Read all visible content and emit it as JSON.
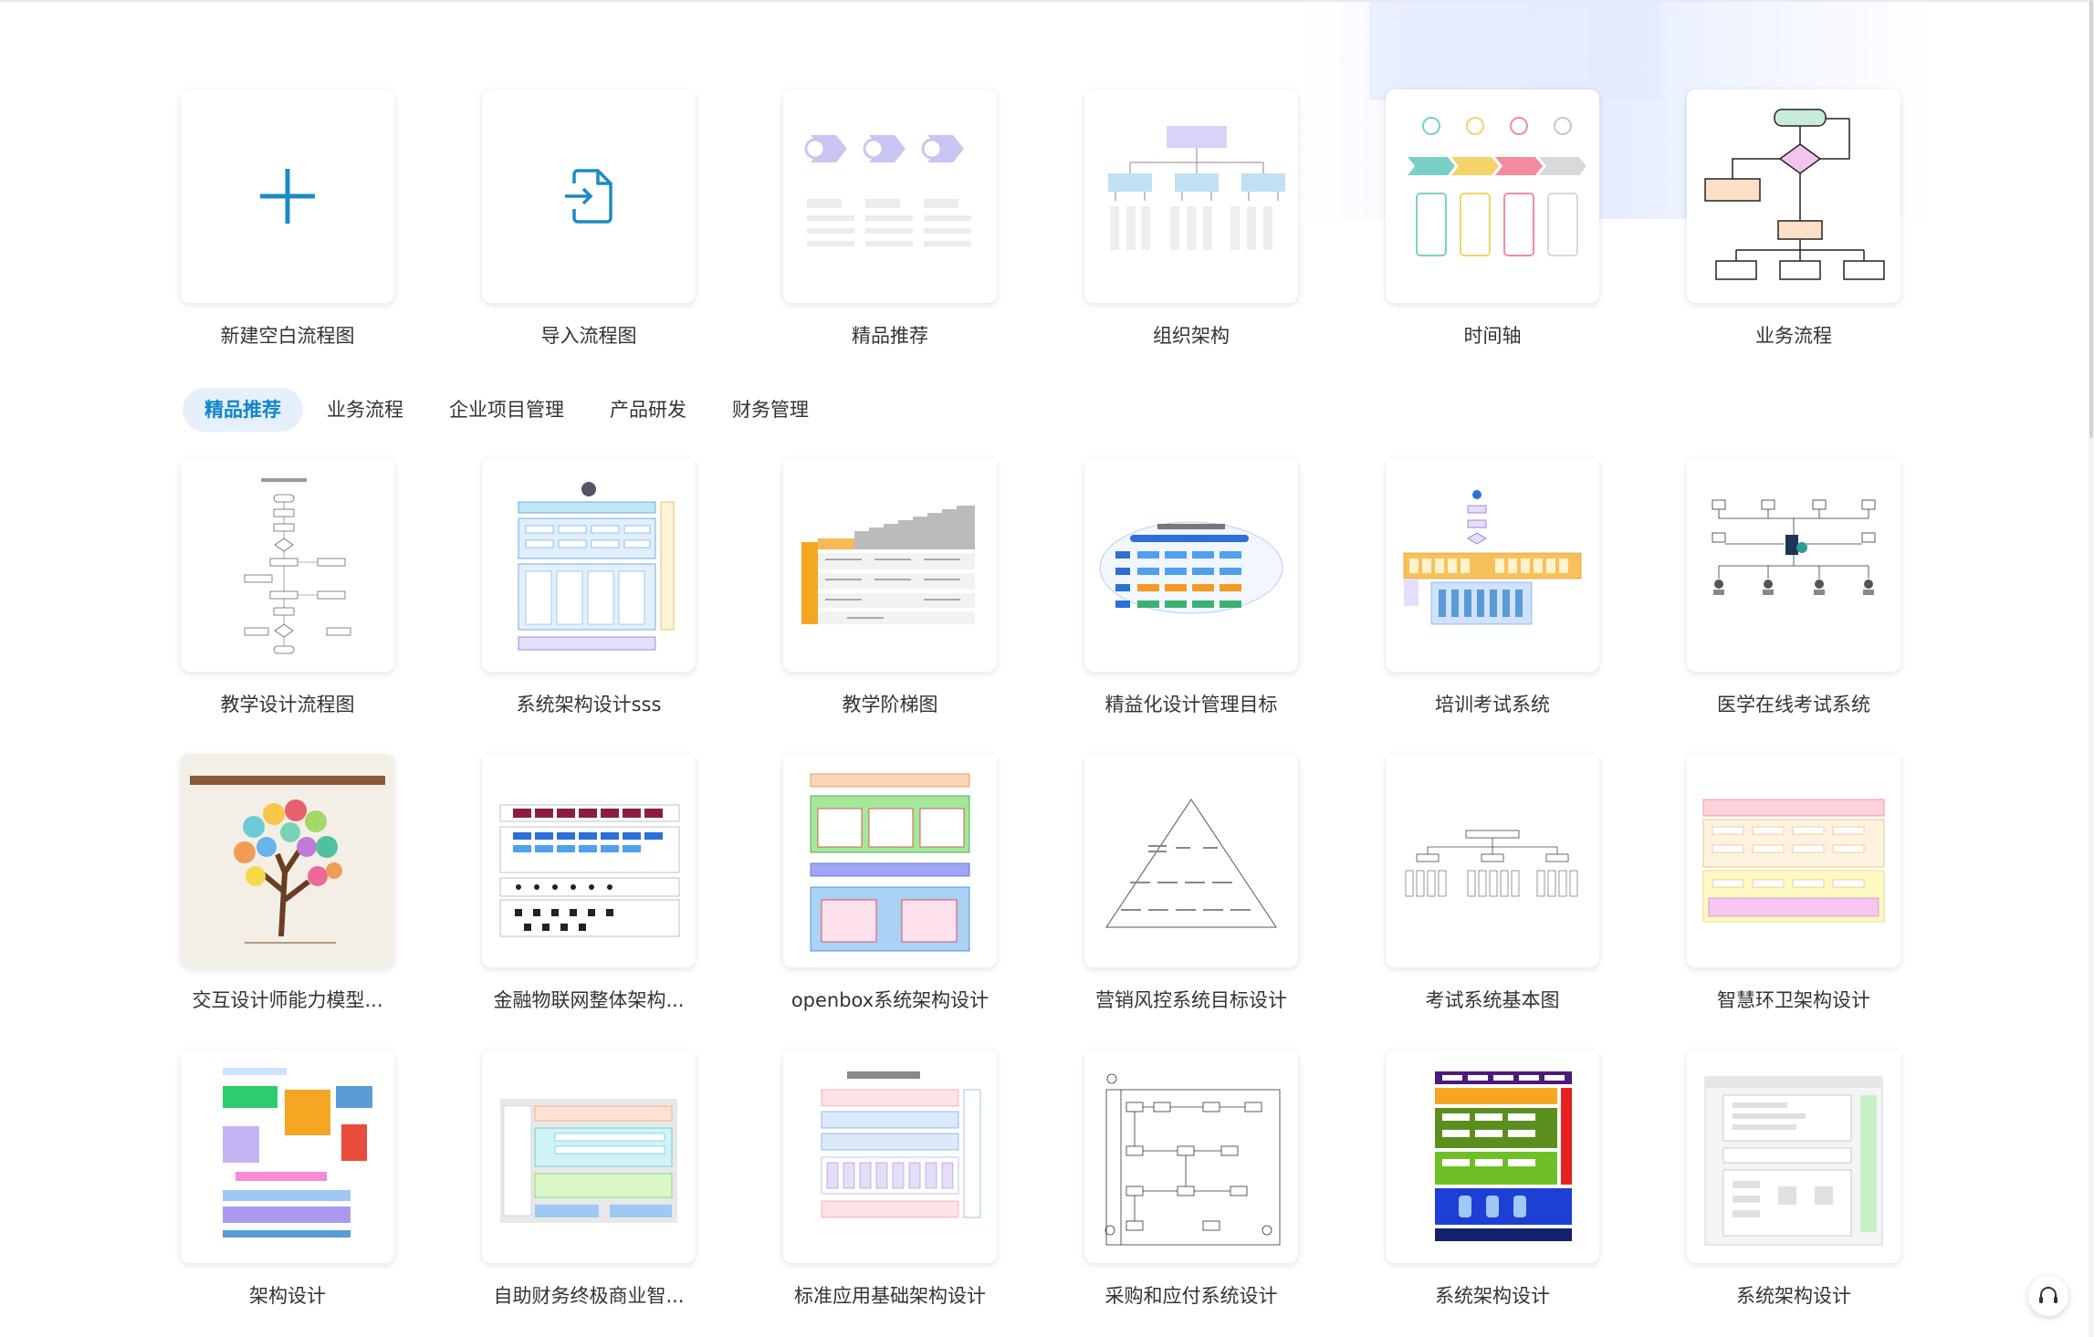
{
  "quick_actions": [
    {
      "label": "新建空白流程图",
      "icon": "plus-icon"
    },
    {
      "label": "导入流程图",
      "icon": "import-file-icon"
    },
    {
      "label": "精品推荐",
      "icon": "premium-preview"
    },
    {
      "label": "组织架构",
      "icon": "org-chart-preview"
    },
    {
      "label": "时间轴",
      "icon": "timeline-preview"
    },
    {
      "label": "业务流程",
      "icon": "business-flow-preview"
    }
  ],
  "tabs": [
    {
      "label": "精品推荐",
      "active": true
    },
    {
      "label": "业务流程",
      "active": false
    },
    {
      "label": "企业项目管理",
      "active": false
    },
    {
      "label": "产品研发",
      "active": false
    },
    {
      "label": "财务管理",
      "active": false
    }
  ],
  "templates": [
    {
      "label": "教学设计流程图"
    },
    {
      "label": "系统架构设计sss"
    },
    {
      "label": "教学阶梯图"
    },
    {
      "label": "精益化设计管理目标"
    },
    {
      "label": "培训考试系统"
    },
    {
      "label": "医学在线考试系统"
    },
    {
      "label": "交互设计师能力模型..."
    },
    {
      "label": "金融物联网整体架构..."
    },
    {
      "label": "openbox系统架构设计"
    },
    {
      "label": "营销风控系统目标设计"
    },
    {
      "label": "考试系统基本图"
    },
    {
      "label": "智慧环卫架构设计"
    },
    {
      "label": "架构设计"
    },
    {
      "label": "自助财务终极商业智..."
    },
    {
      "label": "标准应用基础架构设计"
    },
    {
      "label": "采购和应付系统设计"
    },
    {
      "label": "系统架构设计"
    },
    {
      "label": "系统架构设计"
    }
  ],
  "colors": {
    "accent": "#0e86c9",
    "tab_active_bg": "#e6f0fa",
    "card_bg": "#ffffff"
  }
}
